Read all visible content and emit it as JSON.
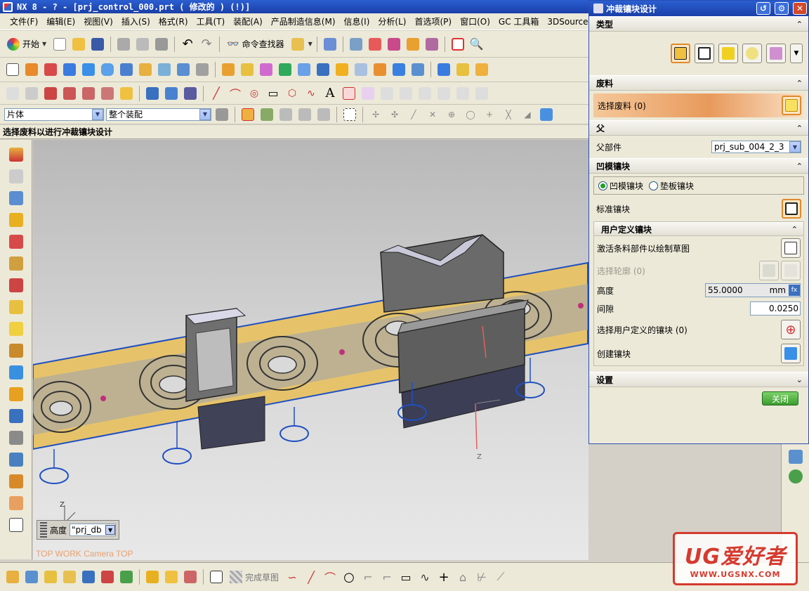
{
  "window": {
    "title": "NX 8 - ? - [prj_control_000.prt ( 修改的 )      (!)]"
  },
  "menu": [
    "文件(F)",
    "编辑(E)",
    "视图(V)",
    "插入(S)",
    "格式(R)",
    "工具(T)",
    "装配(A)",
    "产品制造信息(M)",
    "信息(I)",
    "分析(L)",
    "首选项(P)",
    "窗口(O)",
    "GC 工具箱",
    "3DSource"
  ],
  "toolbar": {
    "start_label": "开始",
    "command_finder_label": "命令查找器",
    "finish_sketch_label": "完成草图"
  },
  "selection": {
    "filter_value": "片体",
    "scope_value": "整个装配"
  },
  "status": {
    "prompt": "选择废料以进行冲裁镶块设计"
  },
  "viewport": {
    "camera_label": "TOP WORK Camera TOP",
    "height_label": "高度",
    "height_value": "\"prj_db"
  },
  "dialog": {
    "title": "冲裁镶块设计",
    "sections": {
      "type": "类型",
      "scrap": "废料",
      "parent": "父",
      "die_insert": "凹模镶块",
      "user_defined": "用户定义镶块",
      "settings": "设置"
    },
    "select_scrap_label": "选择废料 (0)",
    "parent_part_label": "父部件",
    "parent_part_value": "prj_sub_004_2_3",
    "radio_die_insert": "凹模镶块",
    "radio_backing_insert": "垫板镶块",
    "standard_insert_label": "标准镶块",
    "activate_strip_label": "激活条料部件以绘制草图",
    "select_contour_label": "选择轮廓 (0)",
    "height_label": "高度",
    "height_value": "55.0000",
    "height_unit": "mm",
    "gap_label": "间隙",
    "gap_value": "0.0250",
    "select_user_insert_label": "选择用户定义的镶块 (0)",
    "create_insert_label": "创建镶块",
    "close_label": "关闭"
  },
  "watermark": {
    "title": "UG爱好者",
    "url": "WWW.UGSNX.COM"
  },
  "colors": {
    "titlebar": "#1f4fc1",
    "strip": "#e6c36a",
    "scrap_row": "#e89a5c",
    "close_green": "#3c9b2e"
  }
}
